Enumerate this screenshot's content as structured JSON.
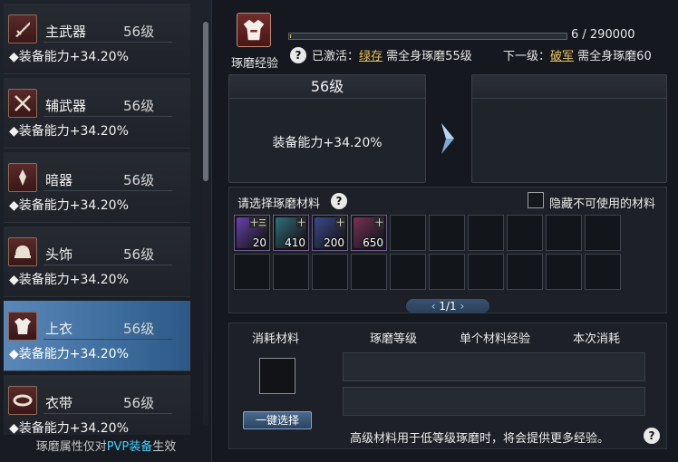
{
  "equipment": [
    {
      "name": "主武器",
      "level": "56级",
      "stat": "◆装备能力+34.20%",
      "icon": "sword-icon"
    },
    {
      "name": "辅武器",
      "level": "56级",
      "stat": "◆装备能力+34.20%",
      "icon": "crossed-blades-icon"
    },
    {
      "name": "暗器",
      "level": "56级",
      "stat": "◆装备能力+34.20%",
      "icon": "dart-icon"
    },
    {
      "name": "头饰",
      "level": "56级",
      "stat": "◆装备能力+34.20%",
      "icon": "helmet-icon"
    },
    {
      "name": "上衣",
      "level": "56级",
      "stat": "◆装备能力+34.20%",
      "icon": "armor-icon",
      "selected": true
    },
    {
      "name": "衣带",
      "level": "56级",
      "stat": "◆装备能力+34.20%",
      "icon": "belt-icon"
    }
  ],
  "pvp_note": {
    "prefix": "琢磨属性仅对",
    "highlight": "PVP装备",
    "suffix": "生效"
  },
  "header": {
    "label": "琢磨经验",
    "progress_text": "6 / 290000",
    "progress_fraction": 2e-05,
    "active_label": "已激活：",
    "active_name": "绿存",
    "active_req": "需全身琢磨55级",
    "next_label": "下一级：",
    "next_name": "破军",
    "next_req": "需全身琢磨60"
  },
  "current_level": {
    "title": "56级",
    "stat": "装备能力+34.20%"
  },
  "next_level": {
    "title": ""
  },
  "materials": {
    "title": "请选择琢磨材料",
    "hide_label": "隐藏不可使用的材料",
    "items": [
      {
        "qty": "20",
        "badge": "十三",
        "color": "#6a3fb0"
      },
      {
        "qty": "410",
        "badge": "十",
        "color": "#2e6f78"
      },
      {
        "qty": "200",
        "badge": "十",
        "color": "#3a4a8c"
      },
      {
        "qty": "650",
        "badge": "十",
        "color": "#7a3050"
      }
    ],
    "pager": "1/1"
  },
  "consume": {
    "headers": [
      "消耗材料",
      "琢磨等级",
      "单个材料经验",
      "本次消耗"
    ],
    "one_click": "一键选择",
    "note": "高级材料用于低等级琢磨时，将会提供更多经验。"
  },
  "help_glyph": "?"
}
